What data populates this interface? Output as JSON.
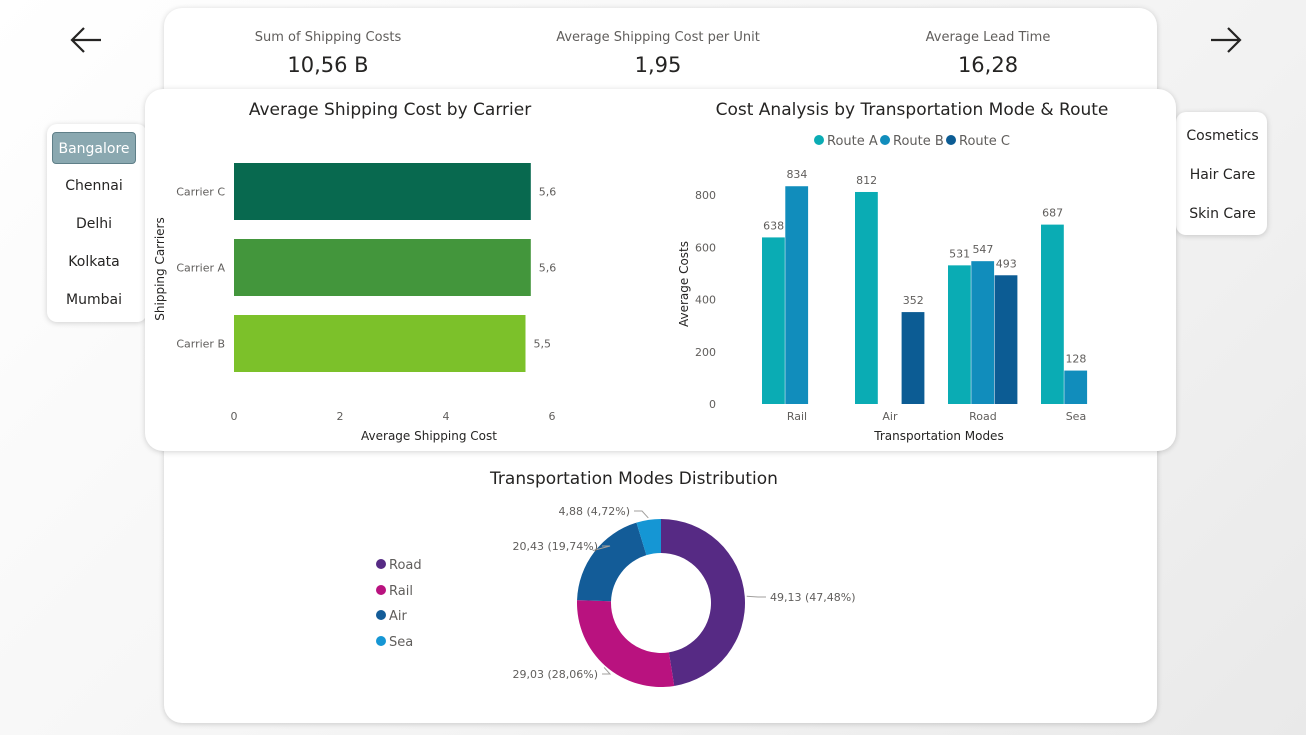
{
  "kpis": [
    {
      "label": "Sum of Shipping Costs",
      "value": "10,56 B"
    },
    {
      "label": "Average Shipping Cost per Unit",
      "value": "1,95"
    },
    {
      "label": "Average Lead Time",
      "value": "16,28"
    }
  ],
  "nav": {
    "back_icon": "arrow-left-icon",
    "forward_icon": "arrow-right-icon"
  },
  "location_slicer": {
    "items": [
      "Bangalore",
      "Chennai",
      "Delhi",
      "Kolkata",
      "Mumbai"
    ],
    "selected": "Bangalore"
  },
  "category_slicer": {
    "items": [
      "Cosmetics",
      "Hair Care",
      "Skin Care"
    ]
  },
  "chart_data": [
    {
      "type": "bar",
      "orientation": "horizontal",
      "title": "Average Shipping Cost by Carrier",
      "xlabel": "Average Shipping Cost",
      "ylabel": "Shipping Carriers",
      "categories": [
        "Carrier C",
        "Carrier A",
        "Carrier B"
      ],
      "values": [
        5.6,
        5.6,
        5.5
      ],
      "data_labels": [
        "5,6",
        "5,6",
        "5,5"
      ],
      "colors": [
        "#08694f",
        "#43963c",
        "#7cc12a"
      ],
      "xlim": [
        0,
        6
      ],
      "xticks": [
        0,
        2,
        4,
        6
      ],
      "grid": false
    },
    {
      "type": "bar",
      "title": "Cost Analysis by Transportation Mode & Route",
      "xlabel": "Transportation Modes",
      "ylabel": "Average Costs",
      "categories": [
        "Rail",
        "Air",
        "Road",
        "Sea"
      ],
      "series": [
        {
          "name": "Route A",
          "color": "#0aacb4",
          "values": [
            638,
            812,
            531,
            687
          ]
        },
        {
          "name": "Route B",
          "color": "#118dbc",
          "values": [
            834,
            null,
            547,
            128
          ]
        },
        {
          "name": "Route C",
          "color": "#0c5c94",
          "values": [
            null,
            352,
            493,
            null
          ]
        }
      ],
      "ylim": [
        0,
        900
      ],
      "yticks": [
        0,
        200,
        400,
        600,
        800
      ],
      "legend": "top-center",
      "grid": false
    },
    {
      "type": "pie",
      "donut": true,
      "title": "Transportation Modes Distribution",
      "labels": [
        "Road",
        "Rail",
        "Air",
        "Sea"
      ],
      "values": [
        49.13,
        29.03,
        20.43,
        4.88
      ],
      "data_labels": [
        "49,13 (47,48%)",
        "29,03 (28,06%)",
        "20,43 (19,74%)",
        "4,88 (4,72%)"
      ],
      "colors": [
        "#562a84",
        "#b9127f",
        "#135c98",
        "#1596d4"
      ],
      "legend": "left"
    }
  ]
}
